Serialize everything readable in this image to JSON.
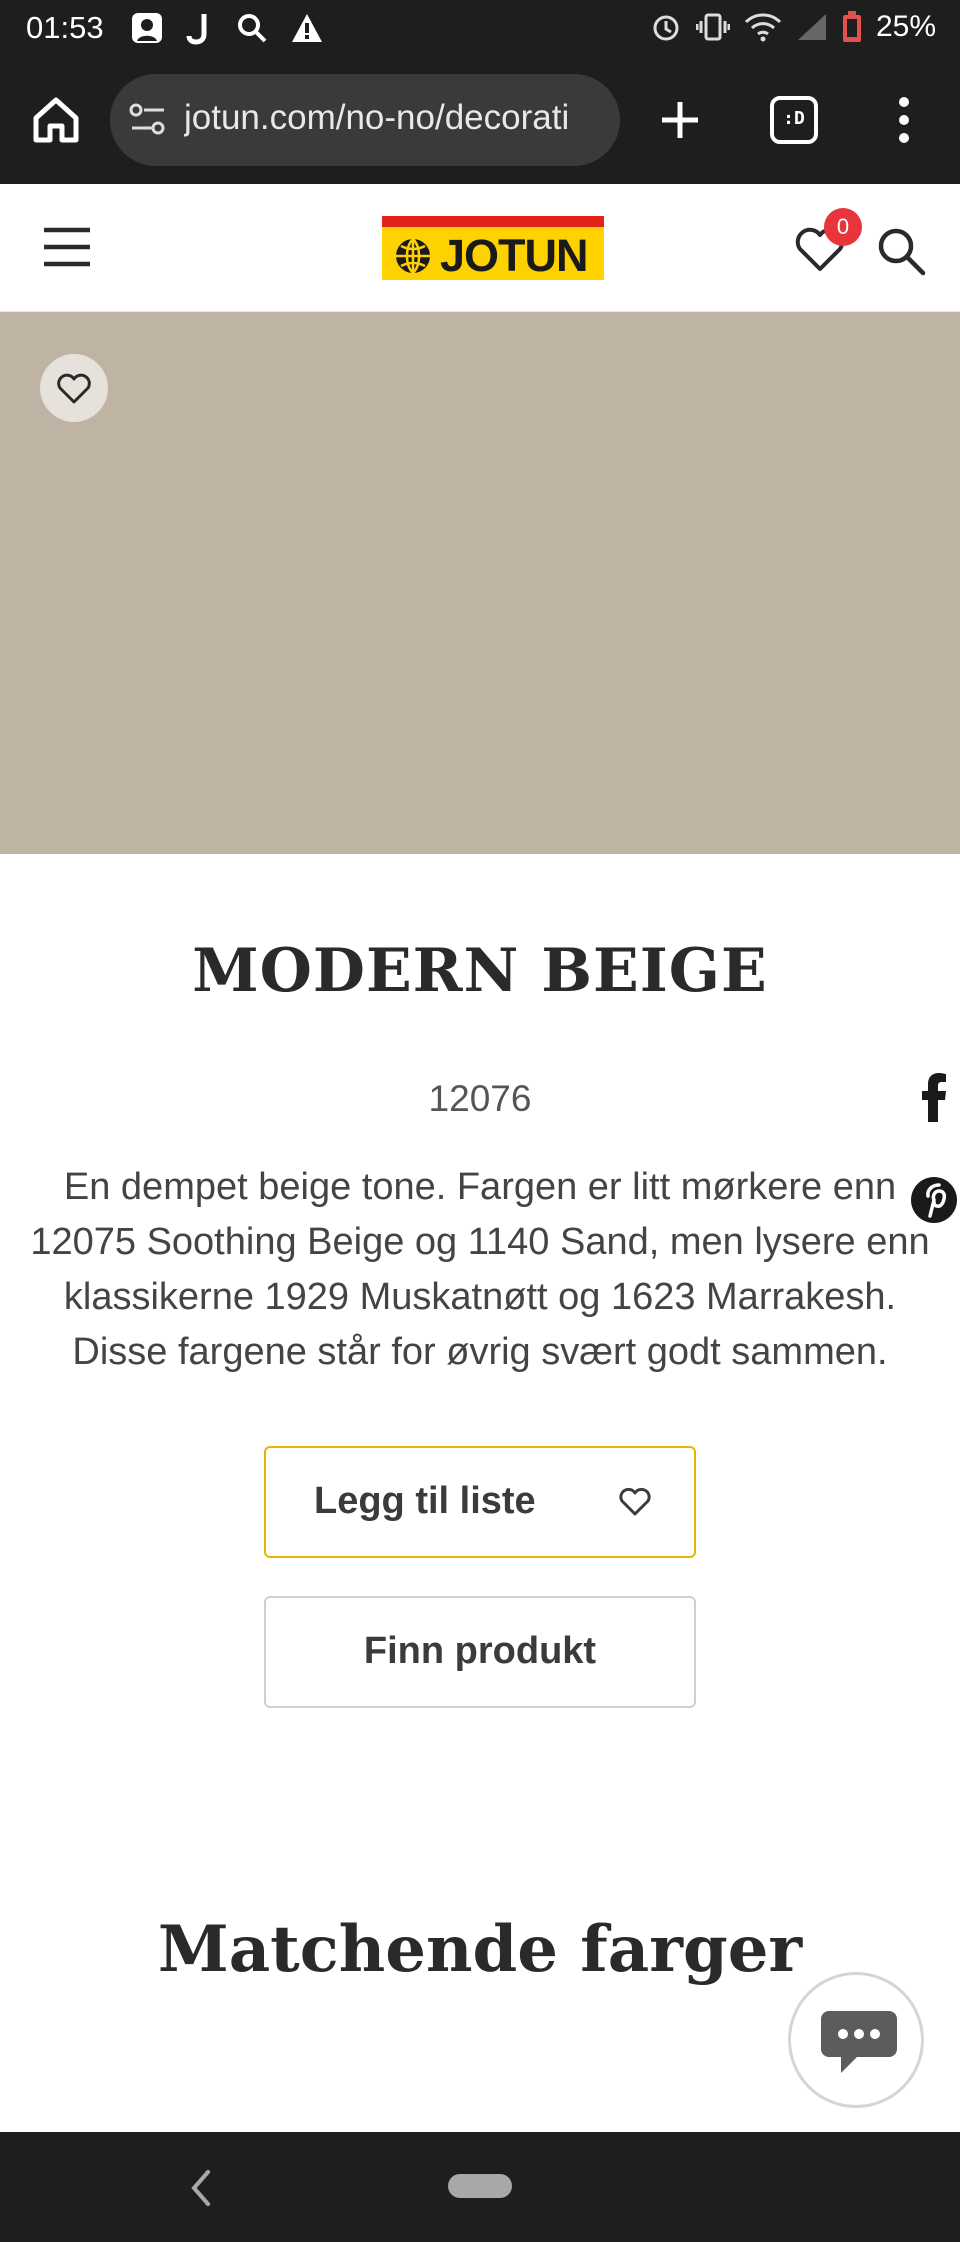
{
  "status_bar": {
    "time": "01:53",
    "battery_percent": "25%",
    "left_icons": [
      "notification-icon",
      "j-icon",
      "search-icon",
      "warning-icon"
    ],
    "right_icons": [
      "alarm-icon",
      "vibrate-icon",
      "wifi-icon",
      "signal-icon",
      "battery-icon"
    ]
  },
  "browser": {
    "url": "jotun.com/no-no/decorati",
    "tabs_label": ":D"
  },
  "header": {
    "logo_text": "JOTUN",
    "wishlist_count": "0",
    "brand_yellow": "#fed100",
    "brand_red": "#e2231a"
  },
  "swatch": {
    "color": "#bfb3a3"
  },
  "product": {
    "name": "MODERN BEIGE",
    "code": "12076",
    "description": "En dempet beige tone. Fargen er litt mørkere enn 12075 Soothing Beige og 1140 Sand, men lysere enn klassikerne 1929 Muskatnøtt og 1623 Marrakesh. Disse fargene står for øvrig svært godt sammen."
  },
  "actions": {
    "add_to_list": "Legg til liste",
    "find_product": "Finn produkt"
  },
  "sections": {
    "matching_colors_title": "Matchende farger"
  },
  "share": {
    "icons": [
      "facebook-icon",
      "pinterest-icon"
    ]
  }
}
